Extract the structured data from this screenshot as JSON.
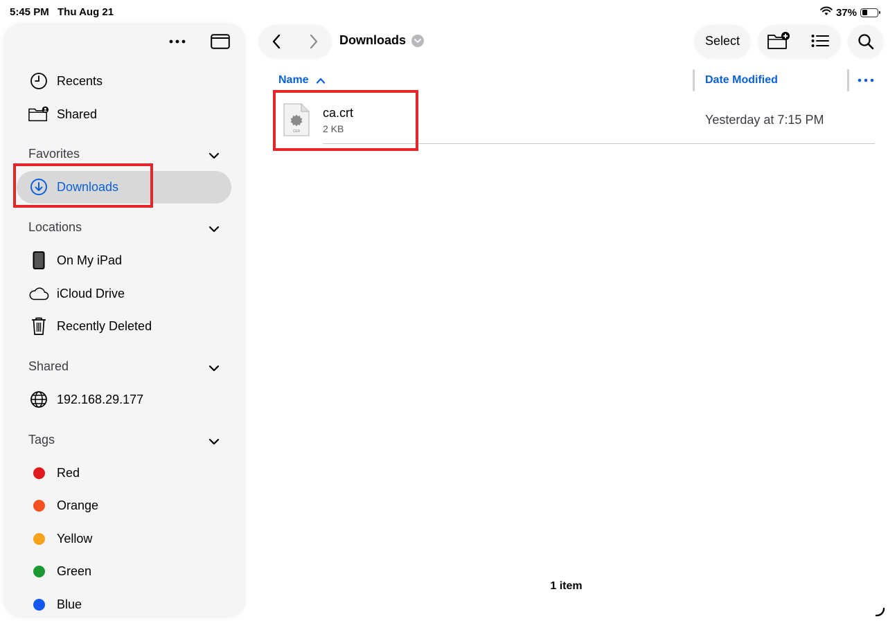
{
  "status": {
    "time": "5:45 PM",
    "date": "Thu Aug 21",
    "battery": "37%",
    "battery_level": 0.37
  },
  "sidebar": {
    "top_items": [
      {
        "label": "Recents",
        "icon": "clock-icon"
      },
      {
        "label": "Shared",
        "icon": "shared-folder-icon"
      }
    ],
    "sections": {
      "favorites": {
        "title": "Favorites",
        "items": [
          {
            "label": "Downloads",
            "icon": "download-circle-icon",
            "selected": true
          }
        ]
      },
      "locations": {
        "title": "Locations",
        "items": [
          {
            "label": "On My iPad",
            "icon": "ipad-icon"
          },
          {
            "label": "iCloud Drive",
            "icon": "cloud-icon"
          },
          {
            "label": "Recently Deleted",
            "icon": "trash-icon"
          }
        ]
      },
      "shared": {
        "title": "Shared",
        "items": [
          {
            "label": "192.168.29.177",
            "icon": "globe-icon"
          }
        ]
      },
      "tags": {
        "title": "Tags",
        "items": [
          {
            "label": "Red",
            "color": "#e0191f"
          },
          {
            "label": "Orange",
            "color": "#f4511e"
          },
          {
            "label": "Yellow",
            "color": "#f6a21a"
          },
          {
            "label": "Green",
            "color": "#1a9a2e"
          },
          {
            "label": "Blue",
            "color": "#1457f0"
          }
        ]
      }
    }
  },
  "toolbar": {
    "title": "Downloads",
    "select_label": "Select"
  },
  "columns": {
    "name": "Name",
    "date_modified": "Date Modified"
  },
  "files": [
    {
      "name": "ca.crt",
      "size": "2 KB",
      "modified": "Yesterday at 7:15 PM",
      "icon_label": "CER"
    }
  ],
  "footer": {
    "item_count": "1 item"
  },
  "colors": {
    "accent": "#0a60d8",
    "highlight": "#e3272b",
    "selection": "#d8d8d8"
  }
}
